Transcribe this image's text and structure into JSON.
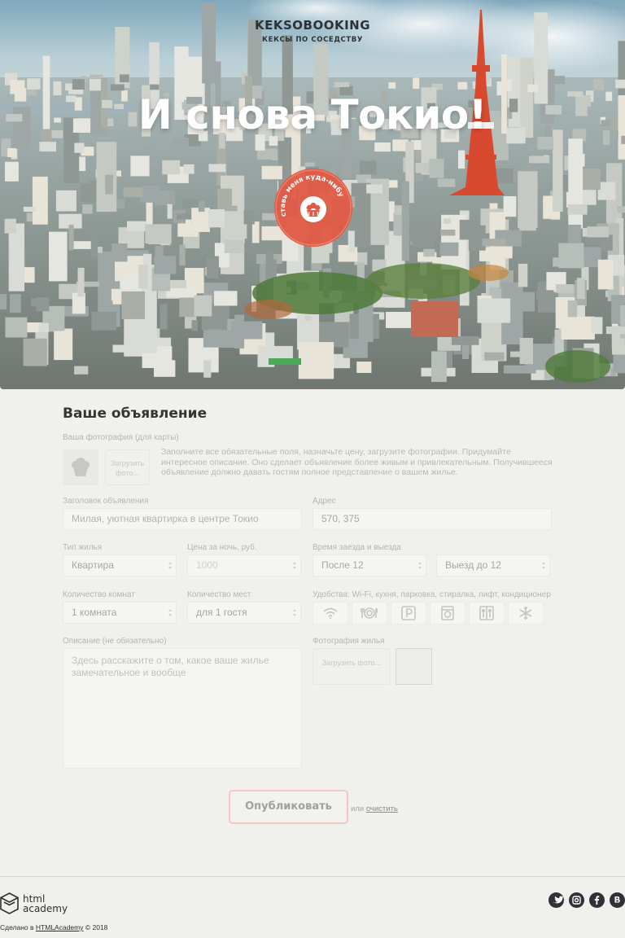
{
  "header": {
    "logo_title": "KEKSOBOOKING",
    "logo_subtitle": "КЕКСЫ ПО СОСЕДСТВУ",
    "hero_title": "И снова Токио!",
    "pin_label": "Поставь меня куда-нибудь"
  },
  "form": {
    "title": "Ваше объявление",
    "avatar_label": "Ваша фотография (для карты)",
    "avatar_upload_label": "Загрузить фото...",
    "hint": "Заполните все обязательные поля, назначьте цену, загрузите фотографии. Придумайте интересное описание. Оно сделает объявление более живым и привлекательным. Получившееся объявление должно давать гостям полное представление о вашем жилье.",
    "title_label": "Заголовок объявления",
    "title_placeholder": "Милая, уютная квартирка в центре Токио",
    "address_label": "Адрес",
    "address_value": "570, 375",
    "type_label": "Тип жилья",
    "type_value": "Квартира",
    "price_label": "Цена за ночь, руб.",
    "price_placeholder": "1000",
    "time_label": "Время заезда и выезда",
    "checkin_value": "После 12",
    "checkout_value": "Выезд до 12",
    "rooms_label": "Количество комнат",
    "rooms_value": "1 комната",
    "capacity_label": "Количество мест",
    "capacity_value": "для 1 гостя",
    "features_label": "Удобства: Wi-Fi, кухня, парковка, стиралка, лифт, кондиционер",
    "features": [
      "wifi-icon",
      "dishwasher-icon",
      "parking-icon",
      "washer-icon",
      "elevator-icon",
      "conditioner-icon"
    ],
    "description_label": "Описание (не обязательно)",
    "description_placeholder": "Здесь расскажите о том, какое ваше жилье замечательное и вообще",
    "photos_label": "Фотография жилья",
    "photos_upload_label": "Загрузить фото...",
    "submit_label": "Опубликовать",
    "or_text": "или",
    "reset_label": "очистить"
  },
  "footer": {
    "academy_line1": "html",
    "academy_line2": "academy",
    "copyright_prefix": "Сделано в",
    "copyright_link": "HTMLAcademy",
    "copyright_suffix": "© 2018",
    "social": [
      "twitter-icon",
      "instagram-icon",
      "facebook-icon",
      "vk-icon"
    ]
  },
  "colors": {
    "accent": "#e05a44",
    "background": "#f0f0ec",
    "text": "#353535"
  }
}
